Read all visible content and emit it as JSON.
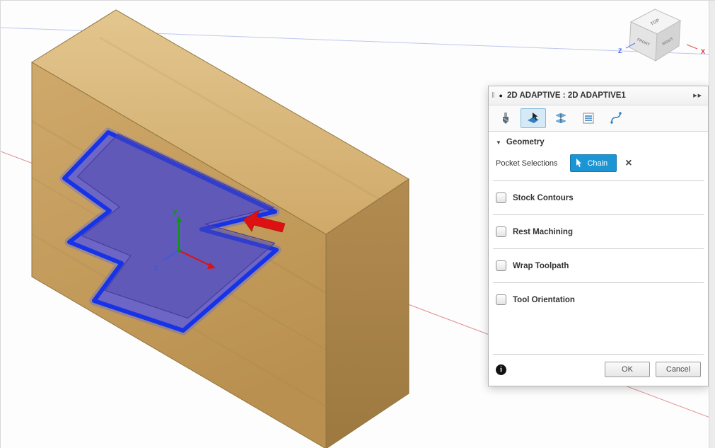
{
  "scene": {
    "triad": {
      "y_label": "Y",
      "z_label": "Z"
    },
    "viewcube": {
      "top": "TOP",
      "front": "FRONT",
      "right": "RIGHT",
      "z_label": "Z",
      "x_label": "X"
    }
  },
  "dialog": {
    "grip": "‖",
    "status_dot": "●",
    "title": "2D ADAPTIVE : 2D ADAPTIVE1",
    "expand": "▶▶",
    "tabs": [
      {
        "name": "tool"
      },
      {
        "name": "geometry"
      },
      {
        "name": "heights"
      },
      {
        "name": "passes"
      },
      {
        "name": "linking"
      }
    ],
    "geometry_section": {
      "caret": "▼",
      "label": "Geometry"
    },
    "pocket_row": {
      "label": "Pocket Selections",
      "chain_label": "Chain",
      "clear": "×"
    },
    "checkboxes": [
      {
        "label": "Stock Contours",
        "checked": false
      },
      {
        "label": "Rest Machining",
        "checked": false
      },
      {
        "label": "Wrap Toolpath",
        "checked": false
      },
      {
        "label": "Tool Orientation",
        "checked": false
      }
    ],
    "footer": {
      "info": "i",
      "ok": "OK",
      "cancel": "Cancel"
    }
  },
  "colors": {
    "accent_blue": "#1b95d4",
    "selection_blue": "#1733e8",
    "pocket_fill": "#6e66c4",
    "stock_wood": "#c9a464",
    "arrow_red": "#dd1111"
  }
}
